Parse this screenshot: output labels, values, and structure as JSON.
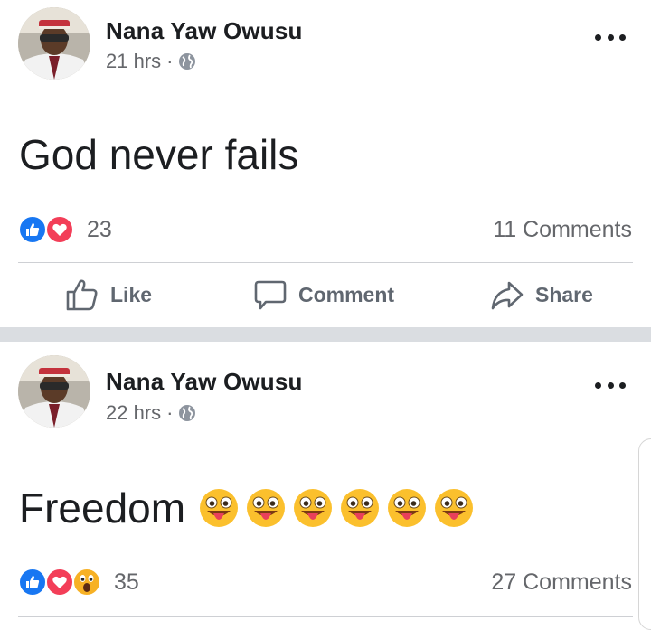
{
  "posts": [
    {
      "author": "Nana Yaw Owusu",
      "time": "21 hrs",
      "separator": "·",
      "privacy_icon": "globe-icon",
      "text": "God never fails",
      "emoji_count": 0,
      "reactions": [
        "like",
        "love"
      ],
      "reaction_count": "23",
      "comments": "11 Comments"
    },
    {
      "author": "Nana Yaw Owusu",
      "time": "22 hrs",
      "separator": "·",
      "privacy_icon": "globe-icon",
      "text": "Freedom",
      "emoji_count": 6,
      "reactions": [
        "like",
        "love",
        "wow"
      ],
      "reaction_count": "35",
      "comments": "27 Comments"
    }
  ],
  "actions": {
    "like": "Like",
    "comment": "Comment",
    "share": "Share"
  },
  "colors": {
    "like_blue": "#1877f2",
    "love_red": "#f33e58",
    "wow_yellow": "#f7b125",
    "meta_gray": "#65676b",
    "band_gray": "#dadde1"
  }
}
